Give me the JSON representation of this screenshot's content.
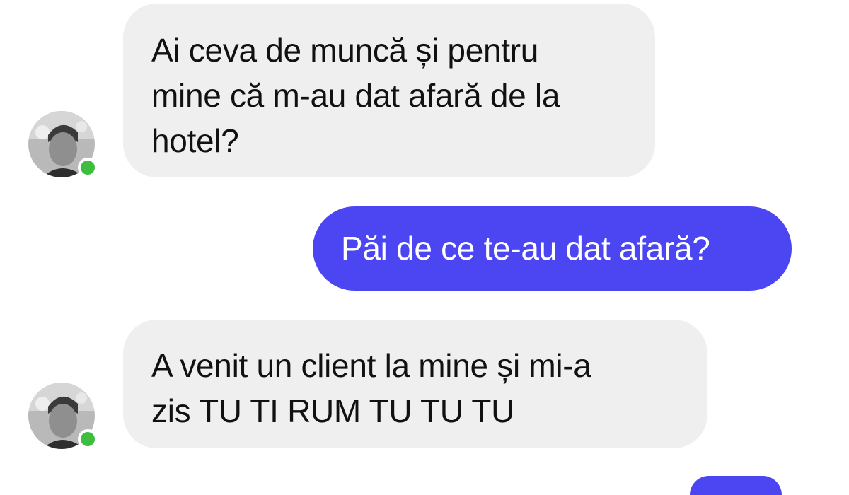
{
  "conversation": {
    "messages": [
      {
        "sender": "contact",
        "lines": [
          "Ai ceva de muncă și pentru",
          "mine că m-au dat afară de la",
          "hotel?"
        ],
        "online": true
      },
      {
        "sender": "me",
        "lines": [
          "Păi de ce te-au dat afară?"
        ]
      },
      {
        "sender": "contact",
        "lines": [
          "A venit un client la mine și mi-a",
          "zis TU TI RUM TU TU TU"
        ],
        "online": true
      }
    ],
    "colors": {
      "incoming_bubble": "#efeff0",
      "outgoing_bubble": "#4c46f2",
      "online_indicator": "#3fbd3f"
    }
  }
}
